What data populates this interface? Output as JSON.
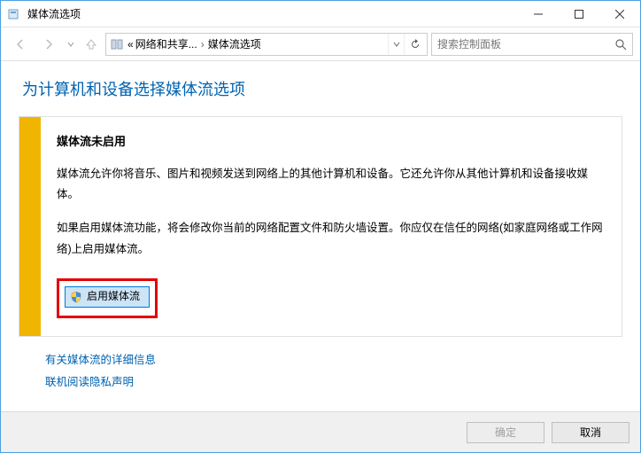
{
  "window": {
    "title": "媒体流选项"
  },
  "nav": {
    "breadcrumb_prefix": "«",
    "breadcrumb_1": "网络和共享...",
    "breadcrumb_2": "媒体流选项",
    "search_placeholder": "搜索控制面板"
  },
  "page": {
    "heading": "为计算机和设备选择媒体流选项"
  },
  "notice": {
    "title": "媒体流未启用",
    "p1": "媒体流允许你将音乐、图片和视频发送到网络上的其他计算机和设备。它还允许你从其他计算机和设备接收媒体。",
    "p2": "如果启用媒体流功能，将会修改你当前的网络配置文件和防火墙设置。你应仅在信任的网络(如家庭网络或工作网络)上启用媒体流。",
    "button": "启用媒体流"
  },
  "links": {
    "more_info": "有关媒体流的详细信息",
    "privacy": "联机阅读隐私声明"
  },
  "footer": {
    "ok": "确定",
    "cancel": "取消"
  }
}
